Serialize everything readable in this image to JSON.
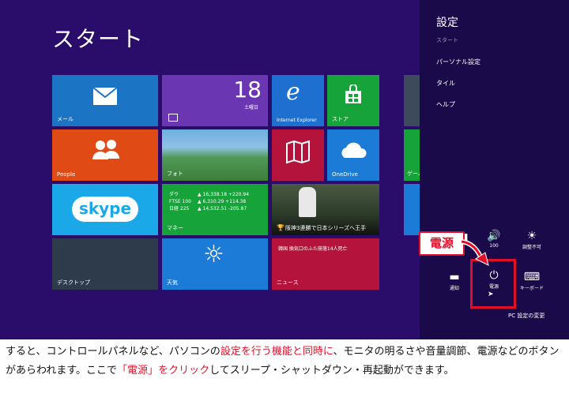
{
  "start": {
    "title": "スタート"
  },
  "tiles": {
    "mail": "メール",
    "calendar_day": "18",
    "calendar_weekday": "土曜日",
    "ie": "Internet Explorer",
    "store": "ストア",
    "people": "People",
    "photos": "フォト",
    "onedrive": "OneDrive",
    "games": "ゲーム",
    "skype": "skype",
    "finance": {
      "label": "マネー",
      "rows": [
        {
          "name": "ダウ",
          "arrow": "▲",
          "value": "16,338.18 +220.94"
        },
        {
          "name": "FTSE 100",
          "arrow": "▲",
          "value": "6,310.29 +114.38"
        },
        {
          "name": "日経 225",
          "arrow": "▲",
          "value": "14,532.51 -205.87"
        }
      ]
    },
    "sports_headline": "阪神3連勝で日本シリーズへ王手",
    "desktop": "デスクトップ",
    "weather": "天気",
    "news_headline": "韓国 換気口のふた崩落14人死亡",
    "news": "ニュース"
  },
  "charms": {
    "title": "設定",
    "subtitle": "スタート",
    "items": [
      "パーソナル設定",
      "タイル",
      "ヘルプ"
    ],
    "quick": {
      "network_label": "",
      "volume_label": "100",
      "brightness_label": "調整不可",
      "notify_label": "通知",
      "power_label": "電源",
      "keyboard_label": "キーボード"
    },
    "pc_settings": "PC 設定の変更"
  },
  "callout": "電源",
  "caption": {
    "p1": "すると、コントロールパネルなど、パソコンの",
    "p2": "設定を行う機能と同時に",
    "p3": "、モニタの明るさや音量調節、電源などのボタンがあらわれます。ここで",
    "p4": "「電源」をクリック",
    "p5": "してスリープ・シャットダウン・再起動ができます。"
  },
  "colors": {
    "background": "#2a0c6b",
    "charms": "#1b0a4a",
    "mail": "#1c74c4",
    "calendar": "#6a36b2",
    "ie": "#1d6fd0",
    "store": "#16a33a",
    "people": "#e04a14",
    "onedrive": "#1b7bd6",
    "skype": "#1aa8e8",
    "finance": "#16a33a",
    "desktop": "#2e3b4a",
    "weather": "#1d7bd8",
    "news": "#b4143c",
    "highlight": "#e0102a"
  }
}
